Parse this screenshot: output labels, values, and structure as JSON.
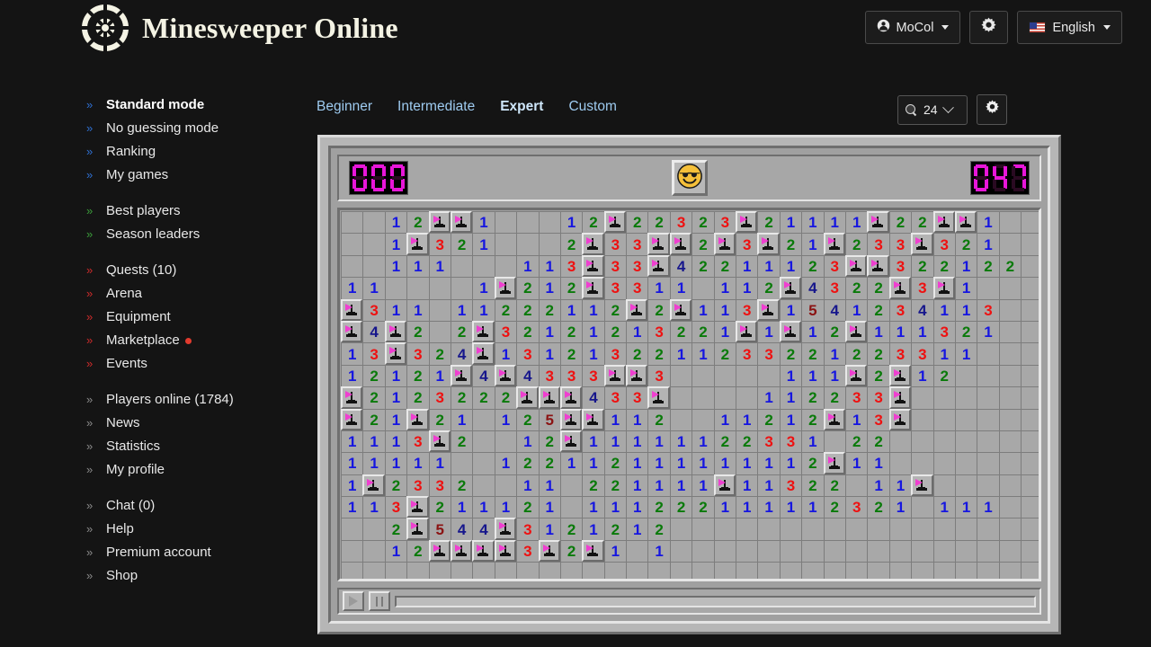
{
  "header": {
    "title": "Minesweeper Online",
    "logo_icon": "minesweeper-logo-icon",
    "user_button": {
      "label": "MoCol",
      "icon": "user-circle-icon"
    },
    "settings_button": {
      "icon": "gear-icon"
    },
    "language_button": {
      "label": "English",
      "icon": "flag-us-icon"
    }
  },
  "sidebar": {
    "groups": [
      {
        "items": [
          {
            "label": "Standard mode",
            "chev": "blue",
            "active": true
          },
          {
            "label": "No guessing mode",
            "chev": "blue",
            "active": false
          },
          {
            "label": "Ranking",
            "chev": "blue",
            "active": false
          },
          {
            "label": "My games",
            "chev": "blue",
            "active": false
          }
        ]
      },
      {
        "items": [
          {
            "label": "Best players",
            "chev": "green",
            "active": false
          },
          {
            "label": "Season leaders",
            "chev": "green",
            "active": false
          }
        ]
      },
      {
        "items": [
          {
            "label": "Quests (10)",
            "chev": "red",
            "active": false
          },
          {
            "label": "Arena",
            "chev": "red",
            "active": false
          },
          {
            "label": "Equipment",
            "chev": "red",
            "active": false
          },
          {
            "label": "Marketplace",
            "chev": "red",
            "active": false,
            "badge_dot": true
          },
          {
            "label": "Events",
            "chev": "red",
            "active": false
          }
        ]
      },
      {
        "items": [
          {
            "label": "Players online (1784)",
            "chev": "gray",
            "active": false
          },
          {
            "label": "News",
            "chev": "gray",
            "active": false
          },
          {
            "label": "Statistics",
            "chev": "gray",
            "active": false
          },
          {
            "label": "My profile",
            "chev": "gray",
            "active": false
          }
        ]
      },
      {
        "items": [
          {
            "label": "Chat (0)",
            "chev": "gray",
            "active": false
          },
          {
            "label": "Help",
            "chev": "gray",
            "active": false
          },
          {
            "label": "Premium account",
            "chev": "gray",
            "active": false
          },
          {
            "label": "Shop",
            "chev": "gray",
            "active": false
          }
        ]
      }
    ]
  },
  "tabs": [
    {
      "label": "Beginner",
      "active": false
    },
    {
      "label": "Intermediate",
      "active": false
    },
    {
      "label": "Expert",
      "active": true
    },
    {
      "label": "Custom",
      "active": false
    }
  ],
  "board_tools": {
    "zoom_value": "24",
    "zoom_icon": "magnifier-icon",
    "dropdown_icon": "chevron-down-icon",
    "settings_icon": "gear-icon"
  },
  "game": {
    "mines_remaining": "000",
    "timer": "047",
    "face_icon": "smiley-sunglasses-icon",
    "face_state": "won",
    "playback": {
      "play_icon": "play-icon",
      "pause_icon": "pause-icon",
      "progress_percent": 0
    },
    "colors": {
      "lcd_on": "#e716d8",
      "lcd_off": "#2a0a22",
      "panel": "#b6b6b6",
      "cell_open": "#a8a8a8",
      "cell_closed": "#b4b4b4",
      "flag": "#ef3fd0",
      "n1": "#1616e0",
      "n2": "#0a7a0a",
      "n3": "#ee1111",
      "n4": "#16168c",
      "n5": "#8b1313"
    },
    "grid": {
      "cols": 32,
      "rows": 17,
      "legend": "'' = blank opened cell, 'F' = flag (closed), digits = adjacent mine counts",
      "rows_data": [
        [
          "",
          "",
          "1",
          "2",
          "F",
          "F",
          "1",
          "",
          "",
          "",
          "1",
          "2",
          "F",
          "2",
          "2",
          "3",
          "2",
          "3",
          "F",
          "2",
          "1",
          "1",
          "1",
          "1",
          "F",
          "2",
          "2",
          "F",
          "F",
          "1",
          ""
        ],
        [
          "",
          "",
          "1",
          "F",
          "3",
          "2",
          "1",
          "",
          "",
          "",
          "2",
          "F",
          "3",
          "3",
          "F",
          "F",
          "2",
          "F",
          "3",
          "F",
          "2",
          "1",
          "F",
          "2",
          "3",
          "3",
          "F",
          "3",
          "2",
          "1",
          ""
        ],
        [
          "",
          "",
          "1",
          "1",
          "1",
          "",
          "",
          "",
          "1",
          "1",
          "3",
          "F",
          "3",
          "3",
          "F",
          "4",
          "2",
          "2",
          "1",
          "1",
          "1",
          "2",
          "3",
          "F",
          "F",
          "3",
          "2",
          "2",
          "1",
          "2",
          "2"
        ],
        [
          "1",
          "1",
          "",
          "",
          "",
          "",
          "1",
          "F",
          "2",
          "1",
          "2",
          "F",
          "3",
          "3",
          "1",
          "1",
          "",
          "1",
          "1",
          "2",
          "F",
          "4",
          "3",
          "2",
          "2",
          "F",
          "3",
          "F",
          "1",
          ""
        ],
        [
          "F",
          "3",
          "1",
          "1",
          "",
          "1",
          "1",
          "2",
          "2",
          "2",
          "1",
          "1",
          "2",
          "F",
          "2",
          "F",
          "1",
          "1",
          "3",
          "F",
          "1",
          "5",
          "4",
          "1",
          "2",
          "3",
          "4",
          "1",
          "1",
          "3"
        ],
        [
          "F",
          "4",
          "F",
          "2",
          "",
          "2",
          "F",
          "3",
          "2",
          "1",
          "2",
          "1",
          "2",
          "1",
          "3",
          "2",
          "2",
          "1",
          "F",
          "1",
          "F",
          "1",
          "2",
          "F",
          "1",
          "1",
          "1",
          "3",
          "2",
          "1"
        ],
        [
          "1",
          "3",
          "F",
          "3",
          "2",
          "4",
          "F",
          "1",
          "3",
          "1",
          "2",
          "1",
          "3",
          "2",
          "2",
          "1",
          "1",
          "2",
          "3",
          "3",
          "2",
          "2",
          "1",
          "2",
          "2",
          "3",
          "3",
          "1",
          "1",
          ""
        ],
        [
          "1",
          "2",
          "1",
          "2",
          "1",
          "F",
          "4",
          "F",
          "4",
          "3",
          "3",
          "3",
          "F",
          "F",
          "3",
          "",
          "",
          "",
          "",
          "",
          "1",
          "1",
          "1",
          "F",
          "2",
          "F",
          "1",
          "2",
          "",
          ""
        ],
        [
          "F",
          "2",
          "1",
          "2",
          "3",
          "2",
          "2",
          "2",
          "F",
          "F",
          "F",
          "4",
          "3",
          "3",
          "F",
          "",
          "",
          "",
          "",
          "1",
          "1",
          "2",
          "2",
          "3",
          "3",
          "F",
          "",
          "",
          "",
          ""
        ],
        [
          "F",
          "2",
          "1",
          "F",
          "2",
          "1",
          "",
          "1",
          "2",
          "5",
          "F",
          "F",
          "1",
          "1",
          "2",
          "",
          "",
          "1",
          "1",
          "2",
          "1",
          "2",
          "F",
          "1",
          "3",
          "F",
          "",
          "",
          "",
          ""
        ],
        [
          "1",
          "1",
          "1",
          "3",
          "F",
          "2",
          "",
          "",
          "1",
          "2",
          "F",
          "1",
          "1",
          "1",
          "1",
          "1",
          "1",
          "2",
          "2",
          "3",
          "3",
          "1",
          "",
          "2",
          "2",
          "",
          "",
          "",
          "",
          ""
        ],
        [
          "1",
          "1",
          "1",
          "1",
          "1",
          "",
          "",
          "1",
          "2",
          "2",
          "1",
          "1",
          "2",
          "1",
          "1",
          "1",
          "1",
          "1",
          "1",
          "1",
          "1",
          "2",
          "F",
          "1",
          "1",
          "",
          "",
          "",
          "",
          ""
        ],
        [
          "1",
          "F",
          "2",
          "3",
          "3",
          "2",
          "",
          "",
          "1",
          "1",
          "",
          "2",
          "2",
          "1",
          "1",
          "1",
          "1",
          "F",
          "1",
          "1",
          "3",
          "2",
          "2",
          "",
          "1",
          "1",
          "F",
          "",
          "",
          ""
        ],
        [
          "1",
          "1",
          "3",
          "F",
          "2",
          "1",
          "1",
          "1",
          "2",
          "1",
          "",
          "1",
          "1",
          "1",
          "2",
          "2",
          "2",
          "1",
          "1",
          "1",
          "1",
          "1",
          "2",
          "3",
          "2",
          "1",
          "",
          "1",
          "1",
          "1"
        ],
        [
          "",
          "",
          "2",
          "F",
          "5",
          "4",
          "4",
          "F",
          "3",
          "1",
          "2",
          "1",
          "2",
          "1",
          "2",
          "",
          "",
          "",
          "",
          "",
          "",
          "",
          "",
          "",
          "",
          "",
          "",
          "",
          "",
          ""
        ],
        [
          "",
          "",
          "1",
          "2",
          "F",
          "F",
          "F",
          "F",
          "3",
          "F",
          "2",
          "F",
          "1",
          "",
          "1",
          "",
          "",
          "",
          "",
          "",
          "",
          "",
          "",
          "",
          "",
          "",
          "",
          "",
          "",
          ""
        ]
      ]
    }
  }
}
